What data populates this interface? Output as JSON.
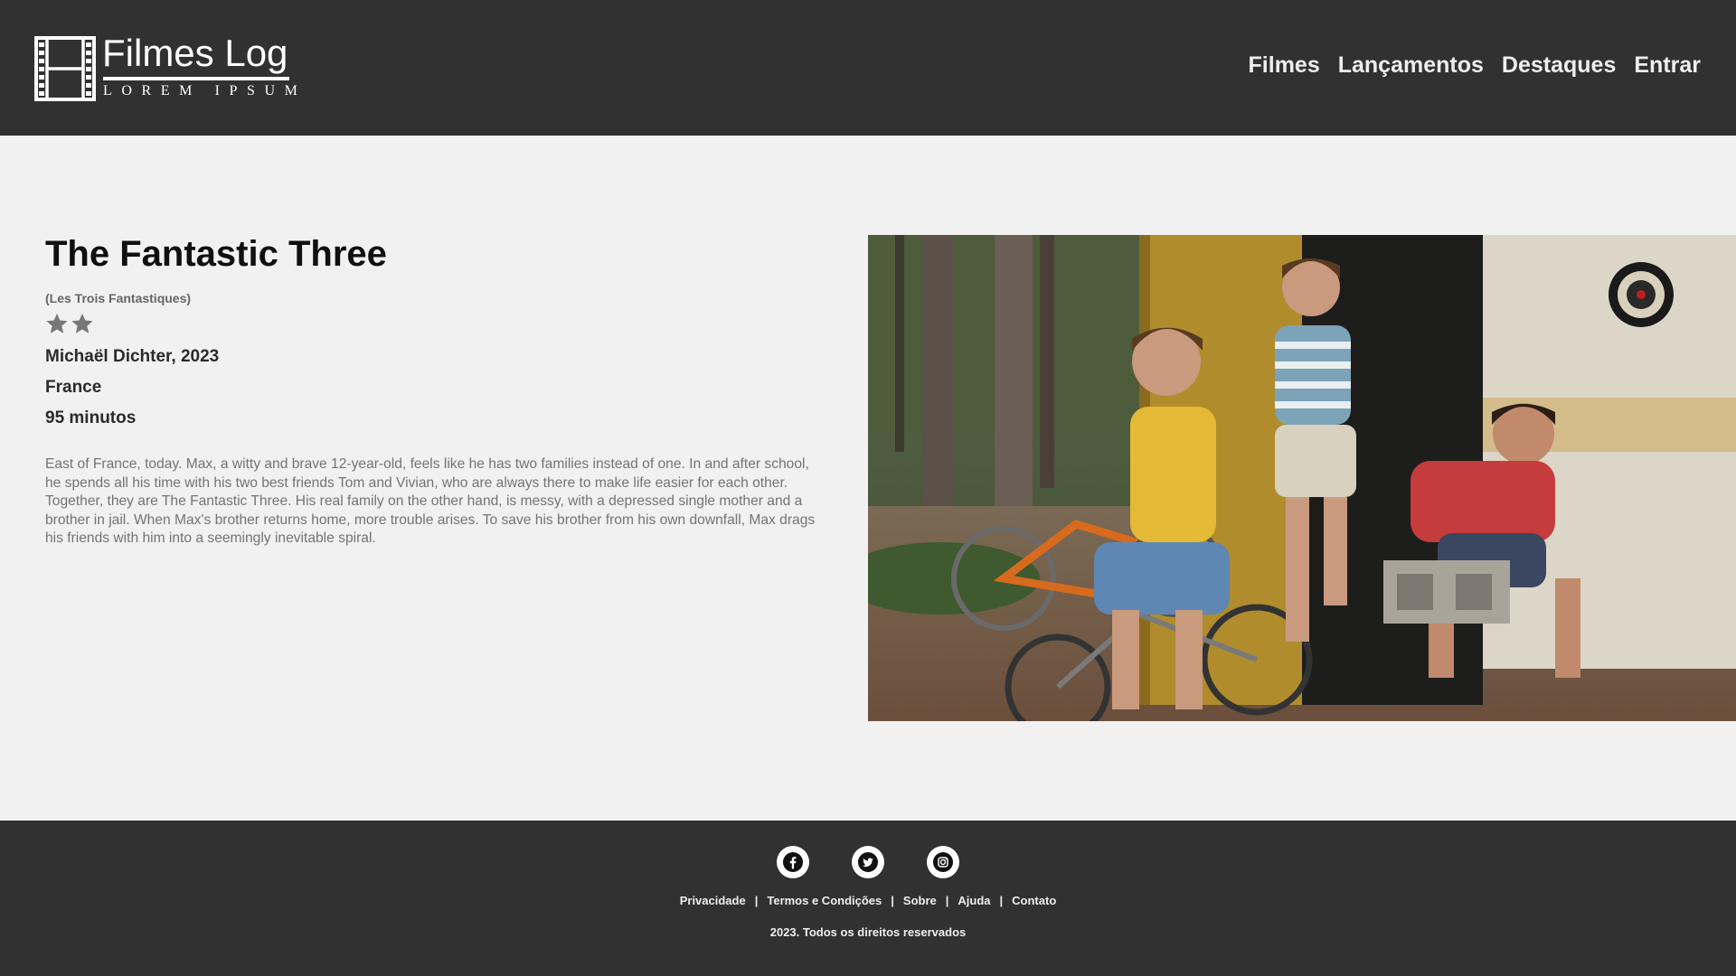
{
  "header": {
    "logo": {
      "title": "Filmes Log",
      "subtitle": "Lorem Ipsum",
      "icon": "film-strip-icon"
    },
    "nav": [
      {
        "label": "Filmes"
      },
      {
        "label": "Lançamentos"
      },
      {
        "label": "Destaques"
      },
      {
        "label": "Entrar"
      }
    ]
  },
  "movie": {
    "title": "The Fantastic Three",
    "original_title": "(Les Trois Fantastiques)",
    "rating": 2,
    "director_year": "Michaël Dichter, 2023",
    "country": "France",
    "duration": "95 minutos",
    "synopsis": "East of France, today. Max, a witty and brave 12-year-old, feels like he has two families instead of one. In and after school, he spends all his time with his two best friends Tom and Vivian, who are always there to make life easier for each other. Together, they are The Fantastic Three. His real family on the other hand, is messy, with a depressed single mother and a brother in jail. When Max's brother returns home, more trouble arises. To save his brother from his own downfall, Max drags his friends with him into a seemingly inevitable spiral."
  },
  "footer": {
    "socials": [
      {
        "icon": "facebook-icon"
      },
      {
        "icon": "twitter-icon"
      },
      {
        "icon": "instagram-icon"
      }
    ],
    "links": [
      {
        "label": "Privacidade"
      },
      {
        "label": "Termos e Condições"
      },
      {
        "label": "Sobre"
      },
      {
        "label": "Ajuda"
      },
      {
        "label": "Contato"
      }
    ],
    "separator": "|",
    "copyright": "2023. Todos os direitos reservados"
  },
  "colors": {
    "header_bg": "#313131",
    "page_bg": "#f1f1f1",
    "star": "#777777"
  }
}
